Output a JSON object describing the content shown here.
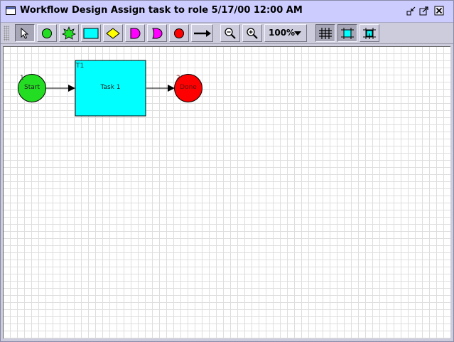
{
  "window": {
    "title": "Workflow Design Assign task to role 5/17/00 12:00 AM"
  },
  "toolbar": {
    "zoom_value": "100%",
    "tools": [
      {
        "name": "select-tool",
        "icon": "pointer-arrow-icon"
      },
      {
        "name": "start-node-tool",
        "icon": "green-circle-icon"
      },
      {
        "name": "event-node-tool",
        "icon": "green-star-icon"
      },
      {
        "name": "task-node-tool",
        "icon": "cyan-rectangle-icon"
      },
      {
        "name": "decision-node-tool",
        "icon": "yellow-diamond-icon"
      },
      {
        "name": "and-node-tool",
        "icon": "magenta-and-gate-icon"
      },
      {
        "name": "or-node-tool",
        "icon": "magenta-or-gate-icon"
      },
      {
        "name": "end-node-tool",
        "icon": "red-circle-icon"
      },
      {
        "name": "transition-tool",
        "icon": "arrow-right-icon"
      },
      {
        "name": "zoom-out-tool",
        "icon": "zoom-out-icon"
      },
      {
        "name": "zoom-in-tool",
        "icon": "zoom-in-icon"
      },
      {
        "name": "grid-toggle",
        "icon": "grid-icon"
      },
      {
        "name": "snap-to-grid-toggle",
        "icon": "snap-grid-icon"
      },
      {
        "name": "align-grid-toggle",
        "icon": "align-grid-icon"
      }
    ]
  },
  "diagram": {
    "nodes": [
      {
        "id": "start",
        "type": "start",
        "label": "1",
        "text": "Start",
        "color": "#22dd22"
      },
      {
        "id": "t1",
        "type": "task",
        "label": "T1",
        "text": "Task 1",
        "color": "#00ffff"
      },
      {
        "id": "done",
        "type": "end",
        "label": "2",
        "text": "Done",
        "color": "#ff0000"
      }
    ],
    "edges": [
      {
        "from": "start",
        "to": "t1"
      },
      {
        "from": "t1",
        "to": "done"
      }
    ]
  },
  "colors": {
    "titlebar": "#ccccff",
    "toolbar": "#ccccdd",
    "pressed_button": "#a6a6b6"
  }
}
